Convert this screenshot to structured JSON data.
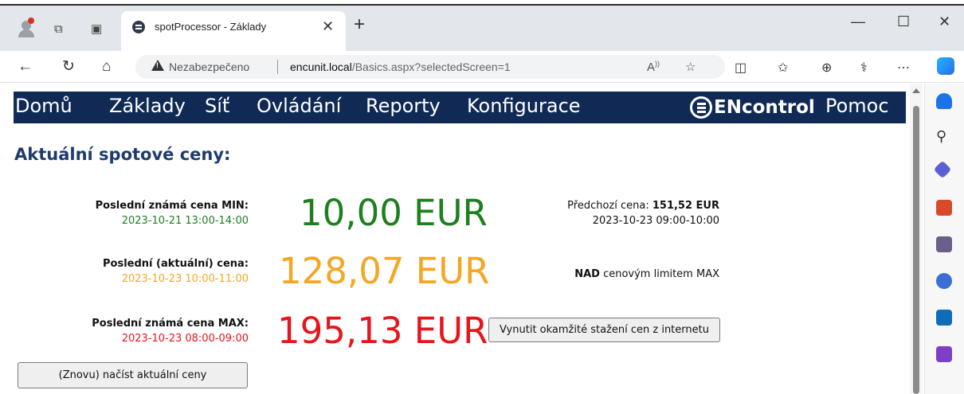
{
  "browser": {
    "tab_title": "spotProcessor - Základy",
    "not_secure_label": "Nezabezpečeno",
    "url_host": "encunit.local",
    "url_path": "/Basics.aspx?selectedScreen=1"
  },
  "menu": {
    "items": [
      "Domů",
      "Základy",
      "Síť",
      "Ovládání",
      "Reporty",
      "Konfigurace"
    ],
    "logo_text": "ENcontrol",
    "help": "Pomoc"
  },
  "page": {
    "title": "Aktuální spotové ceny:"
  },
  "prices": {
    "min": {
      "label": "Poslední známá cena MIN:",
      "time": "2023-10-21 13:00-14:00",
      "value": "10,00 EUR",
      "color": "#1e7f1e"
    },
    "current": {
      "label": "Poslední (aktuální) cena:",
      "time": "2023-10-23 10:00-11:00",
      "value": "128,07 EUR",
      "color": "#f5a623"
    },
    "max": {
      "label": "Poslední známá cena MAX:",
      "time": "2023-10-23 08:00-09:00",
      "value": "195,13 EUR",
      "color": "#e8141b"
    }
  },
  "previous": {
    "label": "Předchozí cena:",
    "value": "151,52 EUR",
    "time": "2023-10-23 09:00-10:00"
  },
  "limit_status": {
    "bold": "NAD",
    "text": " cenovým limitem MAX"
  },
  "buttons": {
    "force_download": "Vynutit okamžité stažení cen z internetu",
    "reload": "(Znovu) načíst aktuální ceny"
  }
}
